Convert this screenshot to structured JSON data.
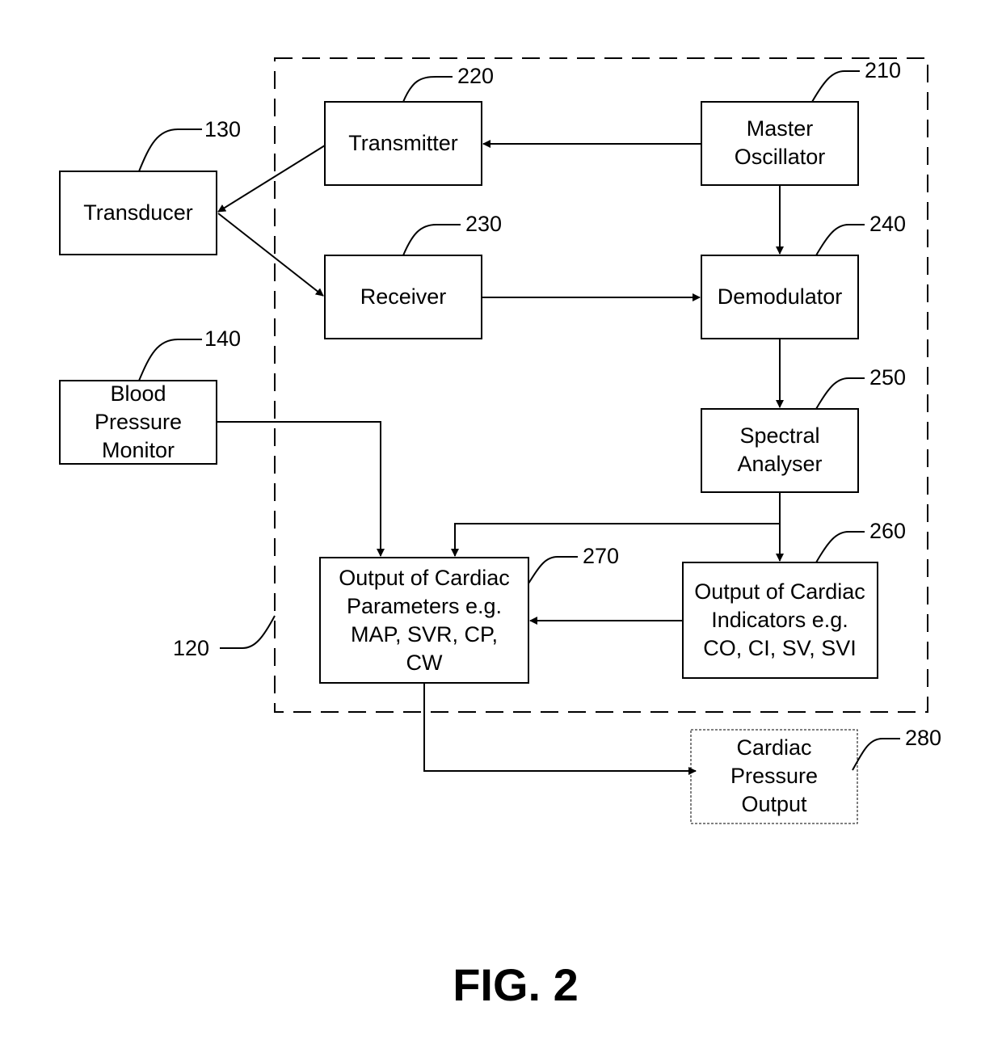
{
  "figure_label": "FIG. 2",
  "system_ref": "120",
  "blocks": {
    "transducer": {
      "ref": "130",
      "lines": [
        "Transducer"
      ]
    },
    "bp_monitor": {
      "ref": "140",
      "lines": [
        "Blood",
        "Pressure",
        "Monitor"
      ]
    },
    "master_oscillator": {
      "ref": "210",
      "lines": [
        "Master",
        "Oscillator"
      ]
    },
    "transmitter": {
      "ref": "220",
      "lines": [
        "Transmitter"
      ]
    },
    "receiver": {
      "ref": "230",
      "lines": [
        "Receiver"
      ]
    },
    "demodulator": {
      "ref": "240",
      "lines": [
        "Demodulator"
      ]
    },
    "spectral_analyser": {
      "ref": "250",
      "lines": [
        "Spectral",
        "Analyser"
      ]
    },
    "cardiac_indicators": {
      "ref": "260",
      "lines": [
        "Output of Cardiac",
        "Indicators e.g.",
        "CO, CI, SV, SVI"
      ]
    },
    "cardiac_parameters": {
      "ref": "270",
      "lines": [
        "Output of Cardiac",
        "Parameters e.g.",
        "MAP, SVR, CP,",
        "CW"
      ]
    },
    "cardiac_pressure_output": {
      "ref": "280",
      "lines": [
        "Cardiac",
        "Pressure",
        "Output"
      ]
    }
  }
}
